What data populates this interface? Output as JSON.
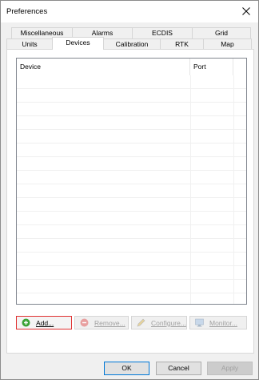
{
  "window": {
    "title": "Preferences",
    "close_icon": "close-icon"
  },
  "tabs": {
    "row1": [
      {
        "label": "Miscellaneous"
      },
      {
        "label": "Alarms"
      },
      {
        "label": "ECDIS"
      },
      {
        "label": "Grid"
      }
    ],
    "row2": [
      {
        "label": "Units"
      },
      {
        "label": "Devices",
        "active": true
      },
      {
        "label": "Calibration"
      },
      {
        "label": "RTK"
      },
      {
        "label": "Map"
      }
    ]
  },
  "devices": {
    "columns": [
      "Device",
      "Port",
      ""
    ],
    "rows": []
  },
  "device_buttons": {
    "add": {
      "label": "Add...",
      "icon": "plus-circle-icon",
      "color": "#3aa335"
    },
    "remove": {
      "label": "Remove...",
      "icon": "minus-circle-icon",
      "color": "#e06a6a"
    },
    "configure": {
      "label": "Configure...",
      "icon": "pencil-icon"
    },
    "monitor": {
      "label": "Monitor...",
      "icon": "monitor-icon"
    }
  },
  "dialog_buttons": {
    "ok": "OK",
    "cancel": "Cancel",
    "apply": "Apply"
  }
}
